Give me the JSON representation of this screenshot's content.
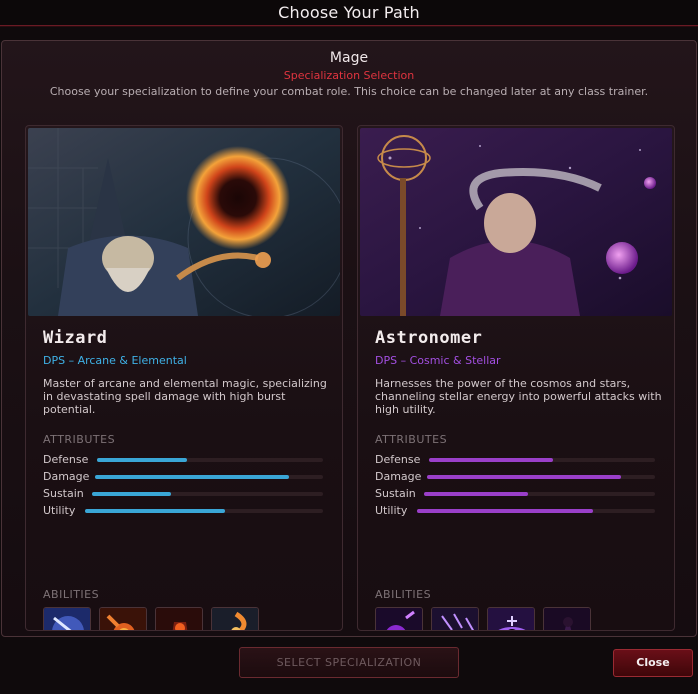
{
  "window": {
    "title": "Choose Your Path"
  },
  "header": {
    "class_name": "Mage",
    "subtitle": "Specialization Selection",
    "description": "Choose your specialization to define your combat role. This choice can be changed later at any class trainer."
  },
  "attributes_heading": "ATTRIBUTES",
  "abilities_heading": "ABILITIES",
  "attribute_labels": [
    "Defense",
    "Damage",
    "Sustain",
    "Utility"
  ],
  "specs": [
    {
      "name": "Wizard",
      "role": "DPS – Arcane & Elemental",
      "description": "Master of arcane and elemental magic, specializing in devastating spell damage with high burst potential.",
      "accent": "#3aa6d6",
      "attributes": {
        "defense": 0.4,
        "damage": 0.85,
        "sustain": 0.34,
        "utility": 0.59
      },
      "abilities": [
        "lightning-bolt-icon",
        "meteor-icon",
        "fire-golem-icon",
        "fire-vortex-icon"
      ]
    },
    {
      "name": "Astronomer",
      "role": "DPS – Cosmic & Stellar",
      "description": "Harnesses the power of the cosmos and stars, channeling stellar energy into powerful attacks with high utility.",
      "accent": "#9a3fc9",
      "attributes": {
        "defense": 0.55,
        "damage": 0.85,
        "sustain": 0.45,
        "utility": 0.74
      },
      "abilities": [
        "cosmic-orb-icon",
        "star-shower-icon",
        "black-hole-icon",
        "celestial-summon-icon"
      ]
    }
  ],
  "footer": {
    "select_label": "SELECT SPECIALIZATION",
    "close_label": "Close"
  }
}
